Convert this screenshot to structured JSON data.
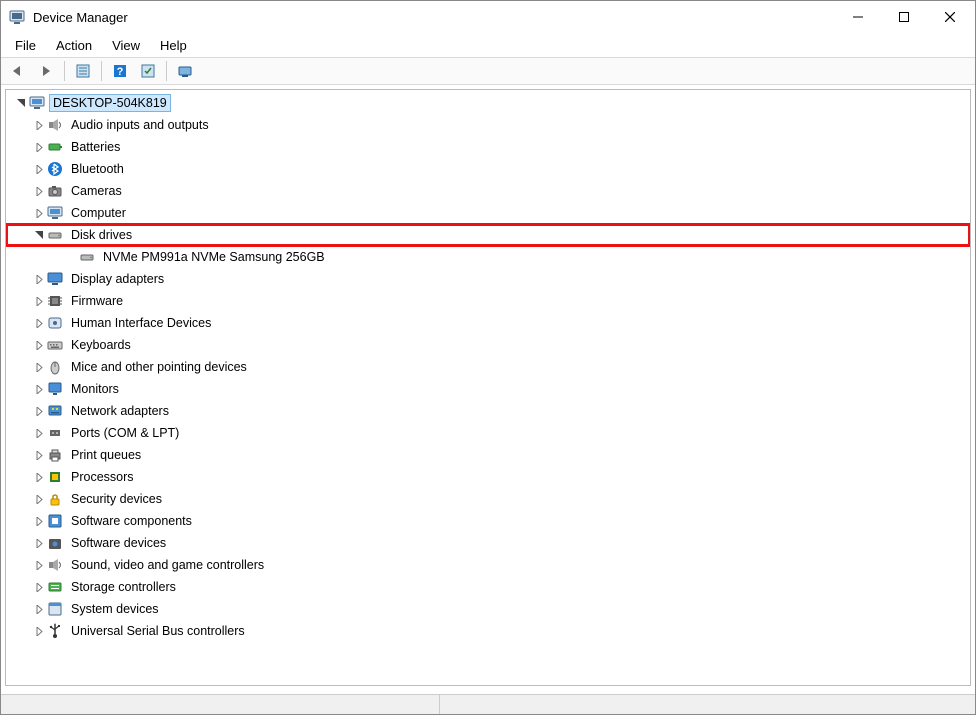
{
  "window": {
    "title": "Device Manager"
  },
  "menus": [
    "File",
    "Action",
    "View",
    "Help"
  ],
  "toolbar": {
    "back": "Back",
    "forward": "Forward",
    "properties": "Properties",
    "help": "Help",
    "scan": "Scan for hardware changes",
    "monitor": "Show hidden devices"
  },
  "root": {
    "name": "DESKTOP-504K819",
    "selected": true
  },
  "categories": [
    {
      "id": "audio",
      "label": "Audio inputs and outputs",
      "icon": "speaker-icon",
      "expanded": false
    },
    {
      "id": "batteries",
      "label": "Batteries",
      "icon": "battery-icon",
      "expanded": false
    },
    {
      "id": "bluetooth",
      "label": "Bluetooth",
      "icon": "bluetooth-icon",
      "expanded": false
    },
    {
      "id": "cameras",
      "label": "Cameras",
      "icon": "camera-icon",
      "expanded": false
    },
    {
      "id": "computer",
      "label": "Computer",
      "icon": "computer-icon",
      "expanded": false
    },
    {
      "id": "disk-drives",
      "label": "Disk drives",
      "icon": "disk-icon",
      "expanded": true,
      "highlighted": true,
      "children": [
        {
          "id": "nvme",
          "label": "NVMe PM991a NVMe Samsung 256GB",
          "icon": "disk-icon"
        }
      ]
    },
    {
      "id": "display-adapters",
      "label": "Display adapters",
      "icon": "display-icon",
      "expanded": false
    },
    {
      "id": "firmware",
      "label": "Firmware",
      "icon": "chip-icon",
      "expanded": false
    },
    {
      "id": "hid",
      "label": "Human Interface Devices",
      "icon": "hid-icon",
      "expanded": false
    },
    {
      "id": "keyboards",
      "label": "Keyboards",
      "icon": "keyboard-icon",
      "expanded": false
    },
    {
      "id": "mice",
      "label": "Mice and other pointing devices",
      "icon": "mouse-icon",
      "expanded": false
    },
    {
      "id": "monitors",
      "label": "Monitors",
      "icon": "monitor-icon",
      "expanded": false
    },
    {
      "id": "network",
      "label": "Network adapters",
      "icon": "network-icon",
      "expanded": false
    },
    {
      "id": "ports",
      "label": "Ports (COM & LPT)",
      "icon": "port-icon",
      "expanded": false
    },
    {
      "id": "print-queues",
      "label": "Print queues",
      "icon": "printer-icon",
      "expanded": false
    },
    {
      "id": "processors",
      "label": "Processors",
      "icon": "cpu-icon",
      "expanded": false
    },
    {
      "id": "security",
      "label": "Security devices",
      "icon": "lock-icon",
      "expanded": false
    },
    {
      "id": "software-components",
      "label": "Software components",
      "icon": "component-icon",
      "expanded": false
    },
    {
      "id": "software-devices",
      "label": "Software devices",
      "icon": "software-icon",
      "expanded": false
    },
    {
      "id": "sound",
      "label": "Sound, video and game controllers",
      "icon": "sound-icon",
      "expanded": false
    },
    {
      "id": "storage-controllers",
      "label": "Storage controllers",
      "icon": "storage-icon",
      "expanded": false
    },
    {
      "id": "system-devices",
      "label": "System devices",
      "icon": "system-icon",
      "expanded": false
    },
    {
      "id": "usb",
      "label": "Universal Serial Bus controllers",
      "icon": "usb-icon",
      "expanded": false
    }
  ]
}
